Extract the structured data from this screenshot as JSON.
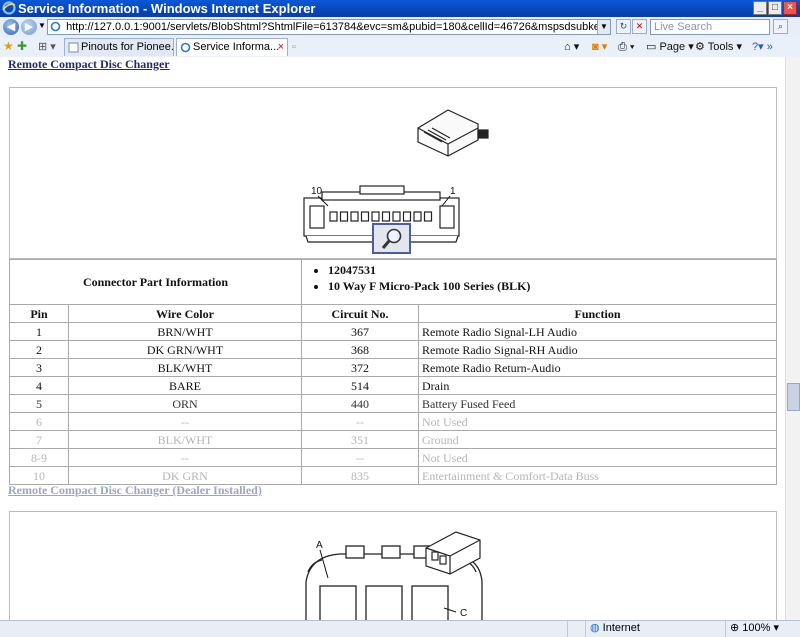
{
  "window": {
    "title": "Service Information - Windows Internet Explorer"
  },
  "address_bar": {
    "url": "http://127.0.0.1:9001/servlets/BlobShtml?ShtmlFile=613784&evc=sm&pubid=180&cellId=46726&mspsdsubkey=954#",
    "search_placeholder": "Live Search"
  },
  "tabs": [
    {
      "label": "Pinouts for Pionee..."
    },
    {
      "label": "Service Informa..."
    }
  ],
  "command_bar": {
    "page_label": "Page",
    "tools_label": "Tools"
  },
  "content": {
    "section1_title": "Remote Compact Disc Changer",
    "figure1_labels": {
      "left_pin": "10",
      "right_pin": "1"
    },
    "connector_part_label": "Connector Part Information",
    "part_info": [
      "12047531",
      "10 Way F Micro-Pack 100 Series (BLK)"
    ],
    "table_headers": {
      "pin": "Pin",
      "wire_color": "Wire Color",
      "circuit": "Circuit No.",
      "function": "Function"
    },
    "rows": [
      {
        "pin": "1",
        "wire": "BRN/WHT",
        "circuit": "367",
        "function": "Remote Radio Signal-LH Audio"
      },
      {
        "pin": "2",
        "wire": "DK GRN/WHT",
        "circuit": "368",
        "function": "Remote Radio Signal-RH Audio"
      },
      {
        "pin": "3",
        "wire": "BLK/WHT",
        "circuit": "372",
        "function": "Remote Radio Return-Audio"
      },
      {
        "pin": "4",
        "wire": "BARE",
        "circuit": "514",
        "function": "Drain"
      },
      {
        "pin": "5",
        "wire": "ORN",
        "circuit": "440",
        "function": "Battery Fused Feed"
      },
      {
        "pin": "6",
        "wire": "--",
        "circuit": "--",
        "function": "Not Used"
      },
      {
        "pin": "7",
        "wire": "BLK/WHT",
        "circuit": "351",
        "function": "Ground"
      },
      {
        "pin": "8-9",
        "wire": "--",
        "circuit": "--",
        "function": "Not Used"
      },
      {
        "pin": "10",
        "wire": "DK GRN",
        "circuit": "835",
        "function": "Entertainment & Comfort-Data Buss"
      }
    ],
    "section2_title": "Remote Compact Disc Changer (Dealer Installed)",
    "figure2_labels": {
      "a": "A",
      "c": "C"
    }
  },
  "status_bar": {
    "zone": "Internet",
    "zoom": "100%"
  },
  "colors": {
    "titlebar": "#0846b8",
    "link": "#1d2e6b",
    "table_border": "#aaaaaa",
    "faded_text": "#b5b5b5"
  }
}
